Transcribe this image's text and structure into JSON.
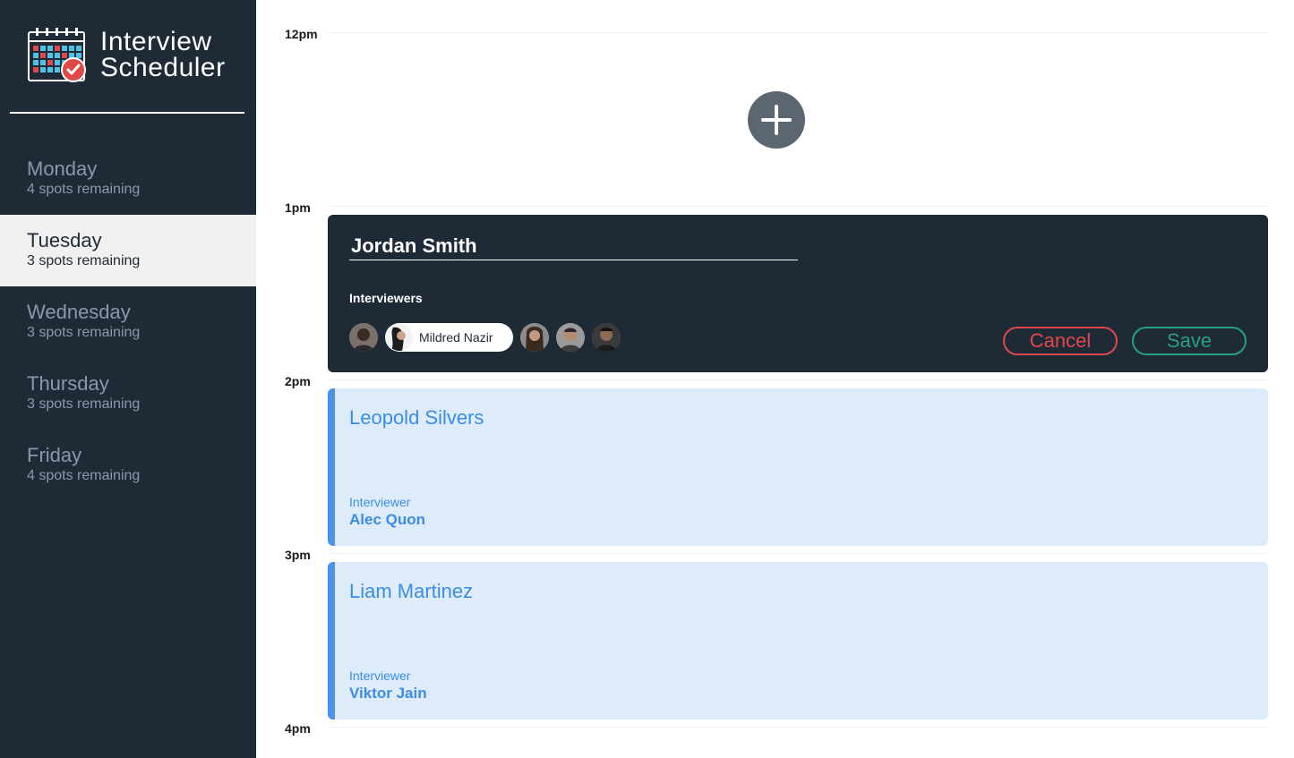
{
  "brand": {
    "line1": "Interview",
    "line2": "Scheduler"
  },
  "days": [
    {
      "name": "Monday",
      "spots": "4 spots remaining",
      "selected": false
    },
    {
      "name": "Tuesday",
      "spots": "3 spots remaining",
      "selected": true
    },
    {
      "name": "Wednesday",
      "spots": "3 spots remaining",
      "selected": false
    },
    {
      "name": "Thursday",
      "spots": "3 spots remaining",
      "selected": false
    },
    {
      "name": "Friday",
      "spots": "4 spots remaining",
      "selected": false
    }
  ],
  "times": [
    "12pm",
    "1pm",
    "2pm",
    "3pm",
    "4pm"
  ],
  "form": {
    "student_name": "Jordan Smith",
    "interviewers_label": "Interviewers",
    "selected_interviewer": "Mildred Nazir",
    "cancel_label": "Cancel",
    "save_label": "Save"
  },
  "appointments": [
    {
      "student": "Leopold Silvers",
      "interviewer_label": "Interviewer",
      "interviewer": "Alec Quon"
    },
    {
      "student": "Liam Martinez",
      "interviewer_label": "Interviewer",
      "interviewer": "Viktor Jain"
    }
  ],
  "colors": {
    "sidebar": "#1f2a37",
    "selected_day_bg": "#f0f0f0",
    "cancel": "#e04848",
    "save": "#27a083",
    "appointment_bg": "#deebfb",
    "appointment_accent": "#4b92ea",
    "add_button": "#5c6670"
  },
  "icons": {
    "logo": "calendar-check-icon",
    "add": "plus-icon",
    "avatar": "person-avatar-icon"
  }
}
